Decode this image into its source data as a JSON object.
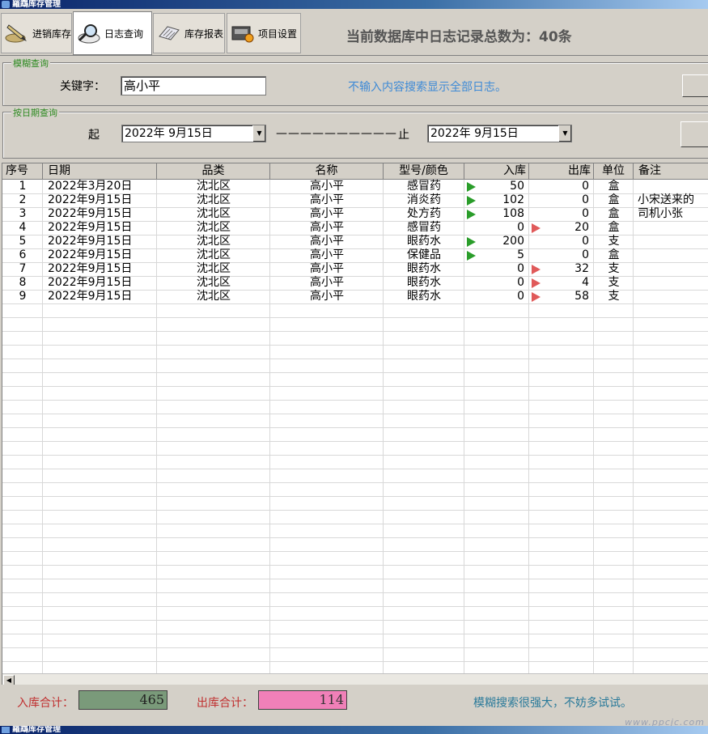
{
  "window": {
    "title": "羅鵡库存管理"
  },
  "toolbar": {
    "tabs": [
      {
        "label": "进销库存",
        "icon": "pen-icon"
      },
      {
        "label": "日志查询",
        "icon": "magnifier-icon"
      },
      {
        "label": "库存报表",
        "icon": "report-scroll-icon"
      },
      {
        "label": "项目设置",
        "icon": "settings-gear-icon"
      }
    ],
    "summary": "当前数据库中日志记录总数为：40条"
  },
  "fuzzy": {
    "legend": "模糊查询",
    "keyword_label": "关键字：",
    "keyword_value": "高小平",
    "hint": "不输入内容搜索显示全部日志。"
  },
  "bydate": {
    "legend": "按日期查询",
    "start_label": "起",
    "start_value": "2022年  9月15日",
    "dashes": "——————————",
    "end_label": "止",
    "end_value": "2022年  9月15日"
  },
  "table": {
    "columns": [
      "序号",
      "日期",
      "品类",
      "名称",
      "型号/颜色",
      "入库",
      "出库",
      "单位",
      "备注"
    ],
    "rows": [
      {
        "no": "1",
        "date": "2022年3月20日",
        "category": "沈北区",
        "name": "高小平",
        "model": "感冒药",
        "in": "50",
        "out": "0",
        "unit": "盒",
        "note": "",
        "arrow": "in"
      },
      {
        "no": "2",
        "date": "2022年9月15日",
        "category": "沈北区",
        "name": "高小平",
        "model": "消炎药",
        "in": "102",
        "out": "0",
        "unit": "盒",
        "note": "小宋送来的",
        "arrow": "in"
      },
      {
        "no": "3",
        "date": "2022年9月15日",
        "category": "沈北区",
        "name": "高小平",
        "model": "处方药",
        "in": "108",
        "out": "0",
        "unit": "盒",
        "note": "司机小张",
        "arrow": "in"
      },
      {
        "no": "4",
        "date": "2022年9月15日",
        "category": "沈北区",
        "name": "高小平",
        "model": "感冒药",
        "in": "0",
        "out": "20",
        "unit": "盒",
        "note": "",
        "arrow": "out"
      },
      {
        "no": "5",
        "date": "2022年9月15日",
        "category": "沈北区",
        "name": "高小平",
        "model": "眼药水",
        "in": "200",
        "out": "0",
        "unit": "支",
        "note": "",
        "arrow": "in"
      },
      {
        "no": "6",
        "date": "2022年9月15日",
        "category": "沈北区",
        "name": "高小平",
        "model": "保健品",
        "in": "5",
        "out": "0",
        "unit": "盒",
        "note": "",
        "arrow": "in"
      },
      {
        "no": "7",
        "date": "2022年9月15日",
        "category": "沈北区",
        "name": "高小平",
        "model": "眼药水",
        "in": "0",
        "out": "32",
        "unit": "支",
        "note": "",
        "arrow": "out"
      },
      {
        "no": "8",
        "date": "2022年9月15日",
        "category": "沈北区",
        "name": "高小平",
        "model": "眼药水",
        "in": "0",
        "out": "4",
        "unit": "支",
        "note": "",
        "arrow": "out"
      },
      {
        "no": "9",
        "date": "2022年9月15日",
        "category": "沈北区",
        "name": "高小平",
        "model": "眼药水",
        "in": "0",
        "out": "58",
        "unit": "支",
        "note": "",
        "arrow": "out"
      }
    ]
  },
  "footer": {
    "in_total_label": "入库合计：",
    "in_total_value": "465",
    "in_total_color": "#7a9a7a",
    "out_total_label": "出库合计：",
    "out_total_value": "114",
    "out_total_color": "#f080b8",
    "hint": "模糊搜索很强大，不妨多试试。",
    "watermark": "www.ppcjc.com"
  },
  "bottom_window": {
    "title": "羅鵡库存管理"
  },
  "colors": {
    "in_arrow": "#2a9d2a",
    "out_arrow": "#e05a5a",
    "legend_text": "#2e8b22",
    "hint_text": "#3e8ad6"
  }
}
